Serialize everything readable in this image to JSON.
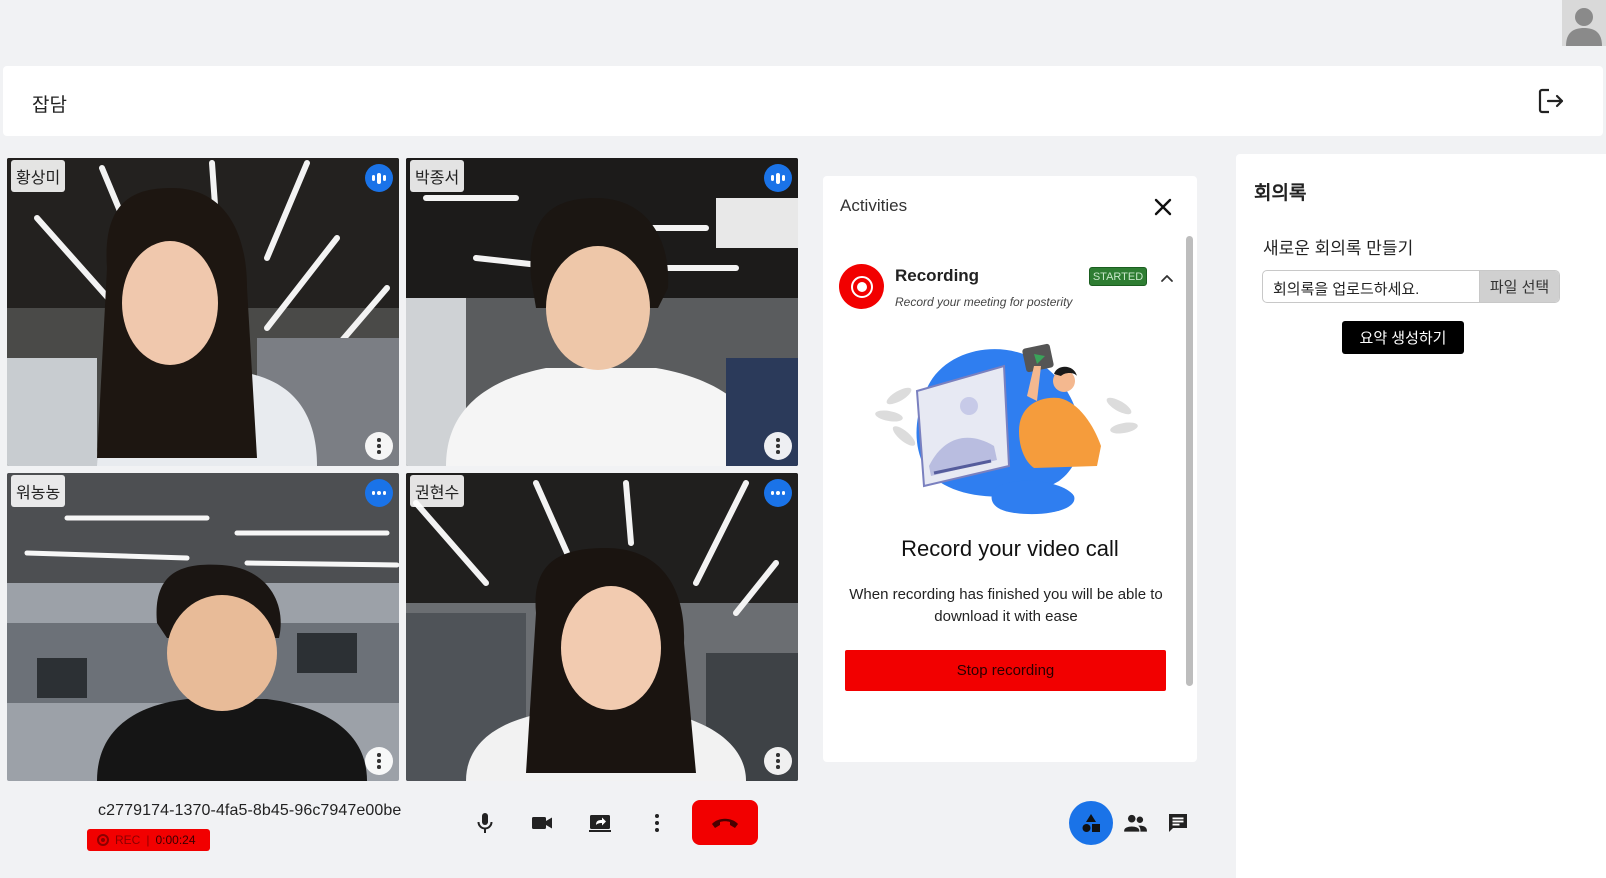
{
  "header": {
    "title": "잡담"
  },
  "participants": [
    {
      "name": "황상미"
    },
    {
      "name": "박종서"
    },
    {
      "name": "워농농"
    },
    {
      "name": "권현수"
    }
  ],
  "session": {
    "meeting_id": "c2779174-1370-4fa5-8b45-96c7947e00be",
    "rec_label": "REC",
    "rec_time": "0:00:24"
  },
  "activities": {
    "title": "Activities",
    "recording": {
      "title": "Recording",
      "subtitle": "Record your meeting for posterity",
      "status": "STARTED",
      "headline": "Record your video call",
      "description": "When recording has finished you will be able to download it with ease",
      "stop_label": "Stop recording"
    }
  },
  "minutes": {
    "title": "회의록",
    "subtitle": "새로운 회의록 만들기",
    "upload_placeholder": "회의록을 업로드하세요.",
    "pick_file_label": "파일 선택",
    "summarize_label": "요약 생성하기"
  },
  "colors": {
    "accent": "#1a73e8",
    "danger": "#f20000",
    "status_green": "#2e7d32"
  },
  "icons": {
    "leave": "logout-icon",
    "mic": "mic-icon",
    "camera": "videocam-icon",
    "share": "screen-share-icon",
    "more": "more-vert-icon",
    "hangup": "call-end-icon",
    "activities": "shapes-icon",
    "participants": "people-icon",
    "chat": "chat-icon"
  }
}
